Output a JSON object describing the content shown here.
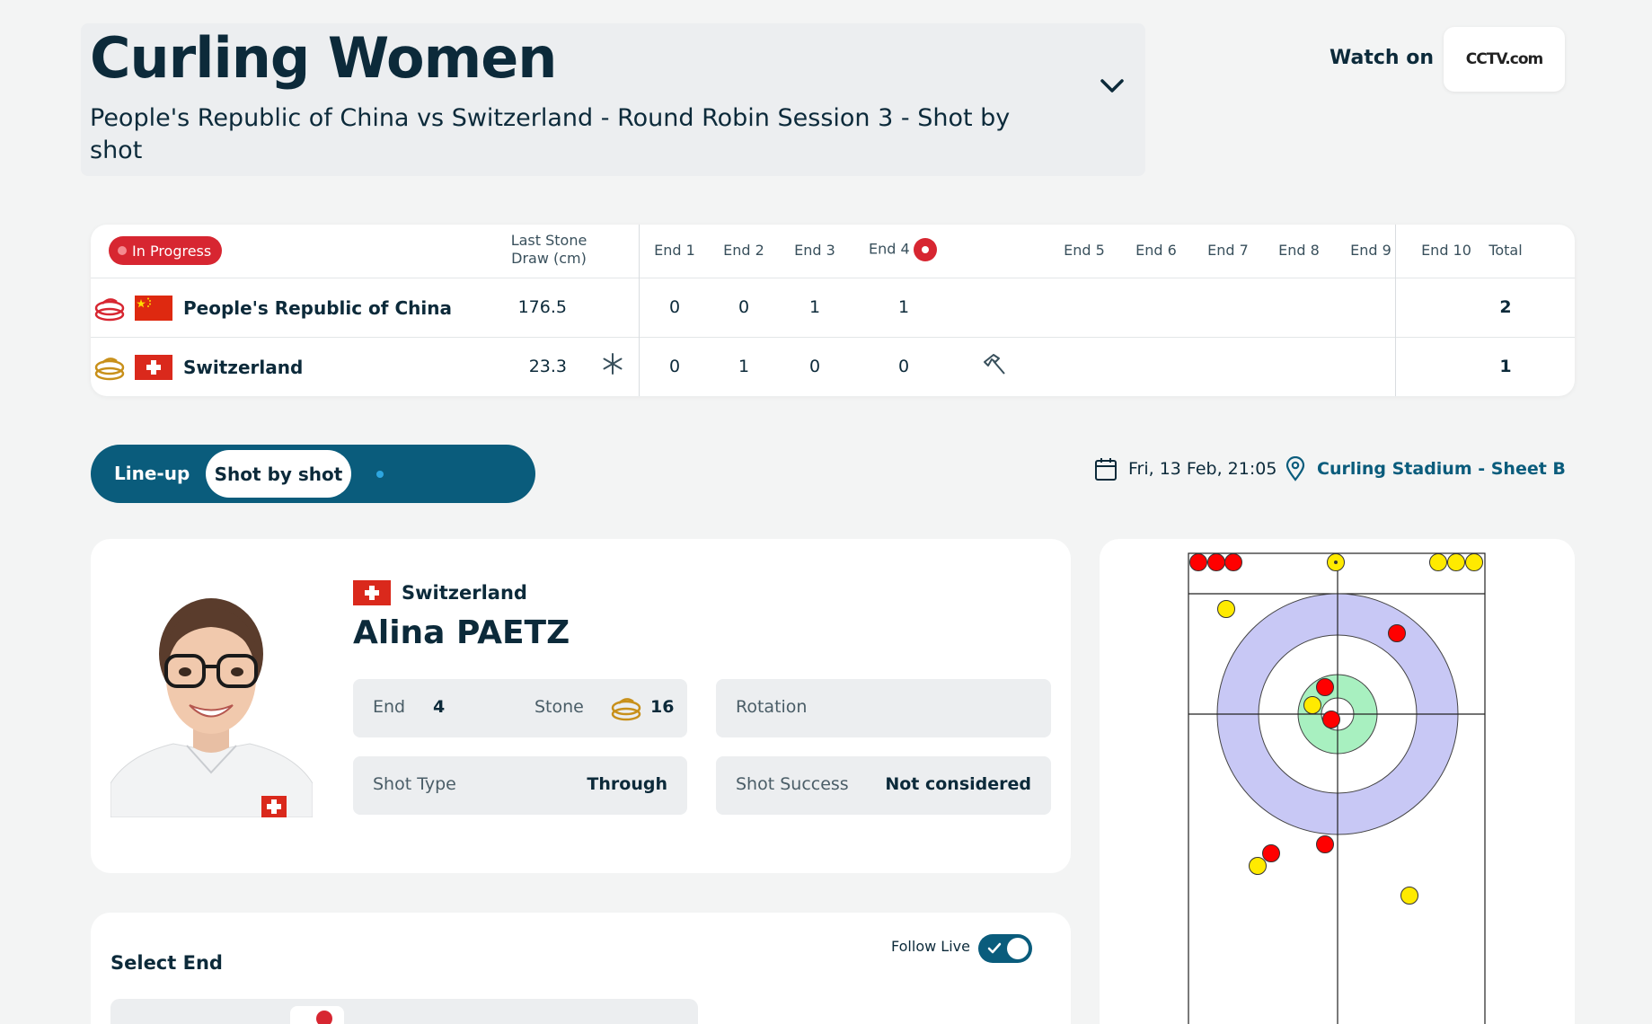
{
  "header": {
    "title": "Curling Women",
    "subtitle": "People's Republic of China vs Switzerland - Round Robin Session 3 - Shot by shot",
    "watch_label": "Watch on",
    "watch_logo_text": "CCTV.com"
  },
  "score": {
    "status": "In Progress",
    "lsd_header": [
      "Last Stone",
      "Draw (cm)"
    ],
    "ends": [
      "End 1",
      "End 2",
      "End 3",
      "End 4",
      "End 5",
      "End 6",
      "End 7",
      "End 8",
      "End 9",
      "End 10"
    ],
    "live_end_index": 3,
    "total_header": "Total",
    "teams": [
      {
        "name": "People's Republic of China",
        "lsd": "176.5",
        "scores": [
          "0",
          "0",
          "1",
          "1",
          "",
          "",
          "",
          "",
          "",
          ""
        ],
        "total": "2",
        "stone_color": "#d72631"
      },
      {
        "name": "Switzerland",
        "lsd": "23.3",
        "scores": [
          "0",
          "1",
          "0",
          "0",
          "",
          "",
          "",
          "",
          "",
          ""
        ],
        "total": "1",
        "stone_color": "#d9a021",
        "hammer_end_index": 4
      }
    ]
  },
  "tabs": {
    "lineup": "Line-up",
    "shot_by_shot": "Shot by shot",
    "active": "shot_by_shot"
  },
  "event": {
    "date": "Fri, 13 Feb, 21:05",
    "venue": "Curling Stadium - Sheet B"
  },
  "player": {
    "country": "Switzerland",
    "name": "Alina PAETZ",
    "end_label": "End",
    "end_value": "4",
    "stone_label": "Stone",
    "stone_value": "16",
    "rotation_label": "Rotation",
    "rotation_value": "",
    "shot_type_label": "Shot Type",
    "shot_type_value": "Through",
    "shot_success_label": "Shot Success",
    "shot_success_value": "Not considered"
  },
  "select_end": {
    "title": "Select End",
    "follow_live_label": "Follow Live",
    "follow_live_on": true
  },
  "colors": {
    "navy": "#0c2a3a",
    "teal": "#0a5c7c",
    "red_stone": "#ff0000",
    "yellow_stone": "#ffea00",
    "ring_outer": "#c8c8f5",
    "ring_button": "#a8f0c0"
  }
}
